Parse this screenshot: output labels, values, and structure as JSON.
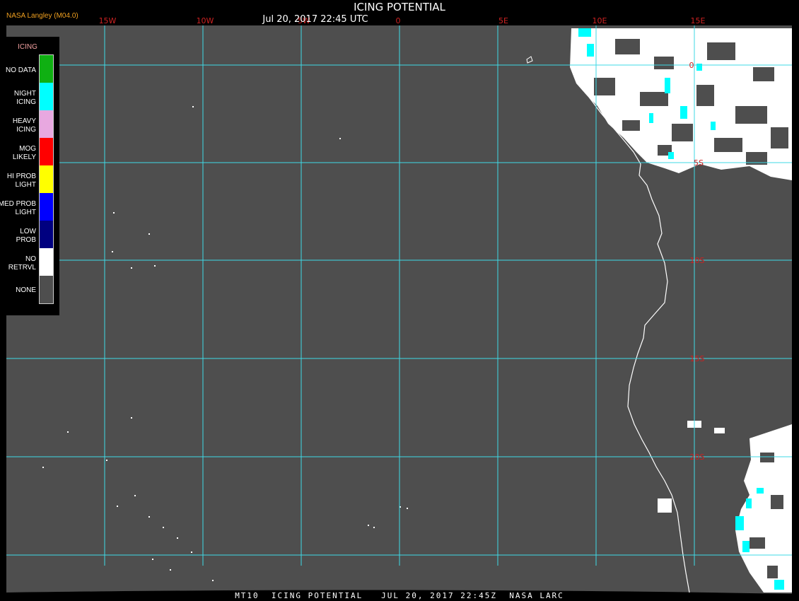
{
  "header": {
    "provider": "NASA Langley (M04.0)",
    "title": "ICING POTENTIAL",
    "timestamp": "Jul 20, 2017 22:45 UTC"
  },
  "footer": {
    "caption": "MT10  ICING POTENTIAL   JUL 20, 2017 22:45Z  NASA LARC"
  },
  "legend": {
    "title": "ICING",
    "items": [
      {
        "label": "NO DATA",
        "color": "#0fb012"
      },
      {
        "label": "NIGHT\nICING",
        "color": "#00ffff"
      },
      {
        "label": "HEAVY\nICING",
        "color": "#e8a8e0"
      },
      {
        "label": "MOG\nLIKELY",
        "color": "#ff0000"
      },
      {
        "label": "HI PROB\nLIGHT",
        "color": "#ffff00"
      },
      {
        "label": "MED PROB\nLIGHT",
        "color": "#0000ff"
      },
      {
        "label": "LOW\nPROB",
        "color": "#000080"
      },
      {
        "label": "NO\nRETRVL",
        "color": "#ffffff"
      },
      {
        "label": "NONE",
        "color": "#4e4e4e"
      }
    ]
  },
  "map": {
    "background_color": "#4e4e4e",
    "grid_color": "#3fd9e6",
    "coastline_color": "#ffffff",
    "longitude_labels": [
      "15W",
      "10W",
      "5W",
      "0",
      "5E",
      "10E",
      "15E"
    ],
    "latitude_labels": [
      "0",
      "5S",
      "10S",
      "15S",
      "20S"
    ],
    "label_color": "#cc2222"
  }
}
